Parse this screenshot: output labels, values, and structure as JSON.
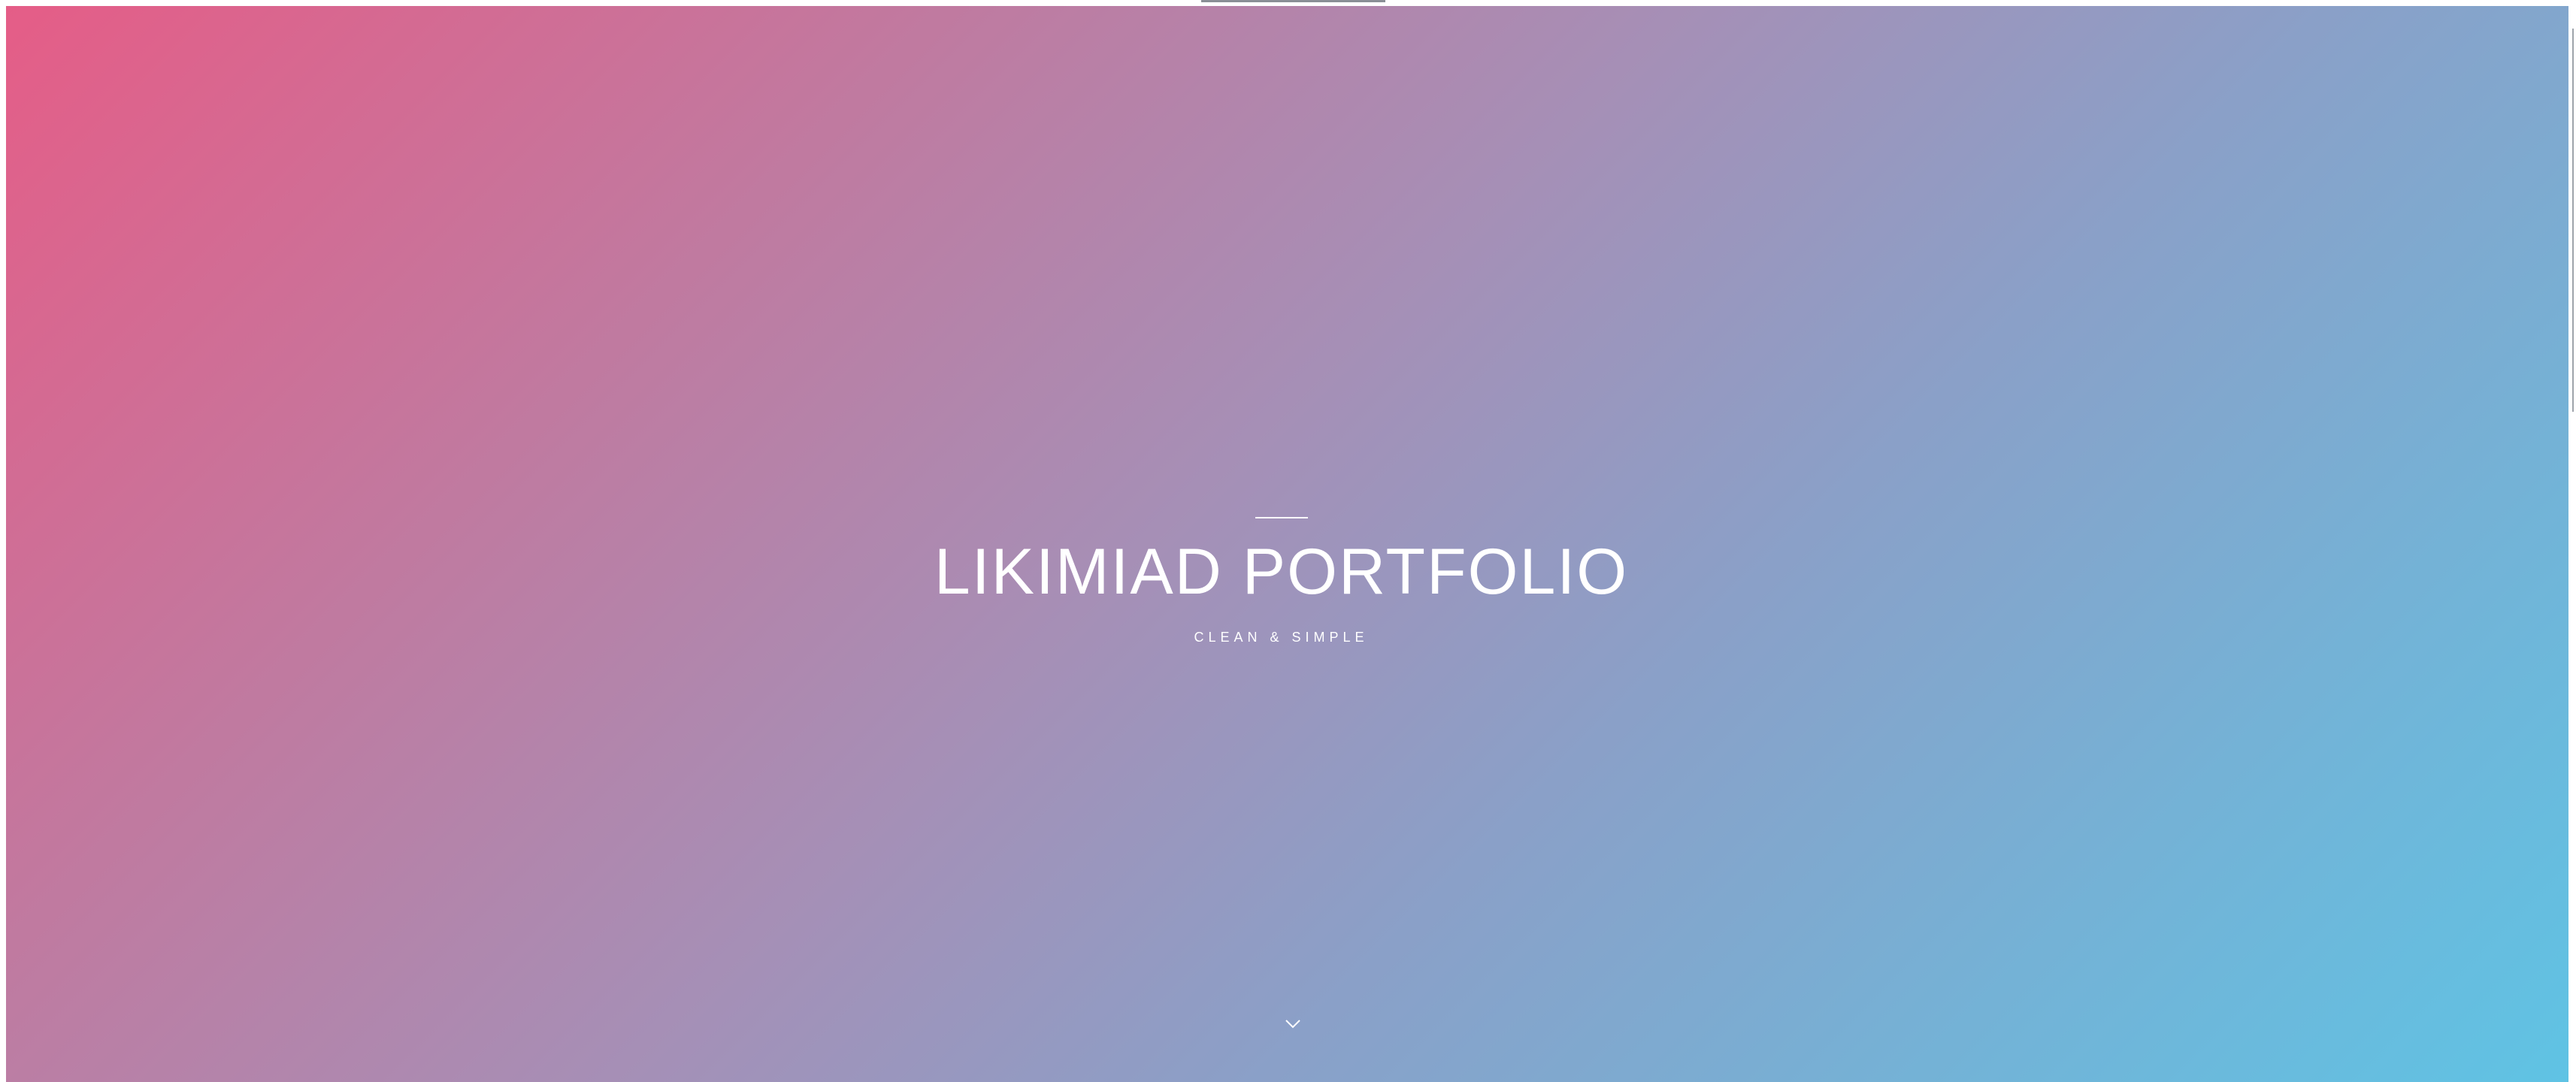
{
  "hero": {
    "title": "LIKIMIAD PORTFOLIO",
    "subtitle": "CLEAN & SIMPLE",
    "scroll_icon": "chevron-down-icon",
    "gradient_start": "#e55d87",
    "gradient_end": "#5fc3e4",
    "text_color": "#ffffff"
  }
}
